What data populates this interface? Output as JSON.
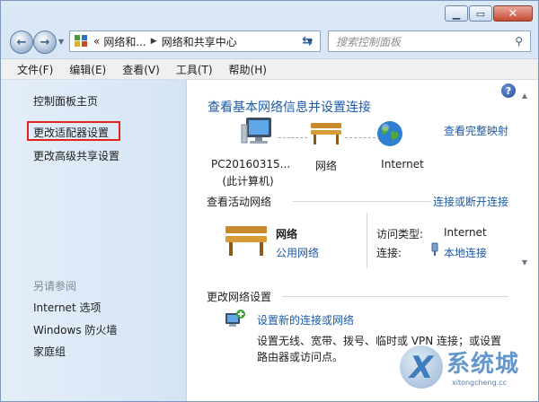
{
  "nav": {
    "breadcrumb": [
      "«",
      "网络和...",
      "网络和共享中心"
    ],
    "search_placeholder": "搜索控制面板"
  },
  "menu": [
    "文件(F)",
    "编辑(E)",
    "查看(V)",
    "工具(T)",
    "帮助(H)"
  ],
  "left_pane": {
    "links": [
      "控制面板主页",
      "更改适配器设置",
      "更改高级共享设置"
    ],
    "see_also_title": "另请参阅",
    "see_also": [
      "Internet 选项",
      "Windows 防火墙",
      "家庭组"
    ]
  },
  "main": {
    "title": "查看基本网络信息并设置连接",
    "full_map_link": "查看完整映射",
    "nodes": {
      "pc_line1": "PC20160315...",
      "pc_line2": "(此计算机)",
      "network": "网络",
      "internet": "Internet"
    },
    "active_header": "查看活动网络",
    "connect_link": "连接或断开连接",
    "active": {
      "name": "网络",
      "type": "公用网络",
      "access_label": "访问类型:",
      "access_value": "Internet",
      "conn_label": "连接:",
      "conn_value": "本地连接"
    },
    "change_header": "更改网络设置",
    "setup_link": "设置新的连接或网络",
    "setup_desc1": "设置无线、宽带、拨号、临时或 VPN 连接；或设置",
    "setup_desc2": "路由器或访问点。"
  },
  "watermark": {
    "brand": "系统城",
    "url": "xitongcheng.cc",
    "logo_letter": "X"
  },
  "colors": {
    "link": "#1b5aa8",
    "highlight_box": "#e0251b"
  }
}
